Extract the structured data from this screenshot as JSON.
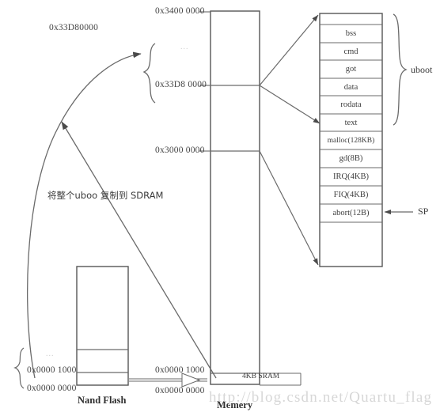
{
  "diagram": {
    "title_watermark": "http://blog.csdn.net/Quartu_flag",
    "addresses": {
      "top_left_note": "0x33D80000",
      "mem_top": "0x3400 0000",
      "mem_uboot_base": "0x33D8 0000",
      "mem_sdram_base": "0x3000 0000",
      "nand_page1": "0x0000 1000",
      "nand_base": "0x0000 0000",
      "mem_low_page1": "0x0000 1000",
      "mem_low_base": "0x0000 0000"
    },
    "memory_column": {
      "caption": "Memery",
      "ellipsis": "...",
      "sram_label": "4KB SRAM"
    },
    "nand_column": {
      "caption": "Nand Flash",
      "ellipsis": "..."
    },
    "uboot_brace_label": "uboot",
    "sp_label": "SP",
    "copy_note": "将整个uboo 复制到 SDRAM",
    "uboot_sections": [
      {
        "label": "bss"
      },
      {
        "label": "cmd"
      },
      {
        "label": "got"
      },
      {
        "label": "data"
      },
      {
        "label": "rodata"
      },
      {
        "label": "text"
      }
    ],
    "runtime_sections": [
      {
        "label": "malloc(128KB)"
      },
      {
        "label": "gd(8B)"
      },
      {
        "label": "IRQ(4KB)"
      },
      {
        "label": "FIQ(4KB)"
      },
      {
        "label": "abort(12B)"
      }
    ],
    "colors": {
      "line": "#555555",
      "text": "#3a3a3a",
      "watermark": "#d7d7d7"
    }
  }
}
